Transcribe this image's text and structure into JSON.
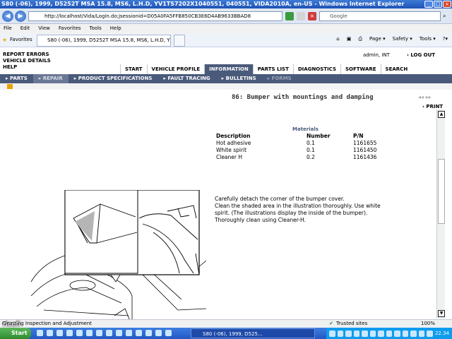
{
  "window": {
    "title": "S80 (-06), 1999, D5252T MSA 15.8, MS6, L.H.D, YV1TS7202X1040551, 040551, VIDA2010A, en-US - Windows Internet Explorer"
  },
  "browser": {
    "url": "http://localhost/Vida/Login.do;jsessionid=D05A0FA5FFB850CB3E6D4AB9633BBAD8",
    "search_placeholder": "Google",
    "menu": [
      "File",
      "Edit",
      "View",
      "Favorites",
      "Tools",
      "Help"
    ],
    "favorites_label": "Favorites",
    "tab_title": "S80 (-06), 1999, D5252T MSA 15.8, MS6, L.H.D, YV1...",
    "commands": [
      "Page ▾",
      "Safety ▾",
      "Tools ▾",
      "?▾"
    ]
  },
  "vida": {
    "header_links": [
      "REPORT ERRORS",
      "VEHICLE DETAILS",
      "HELP"
    ],
    "user": "admin, INT",
    "logout": "LOG OUT",
    "main_tabs": [
      "START",
      "VEHICLE PROFILE",
      "INFORMATION",
      "PARTS LIST",
      "DIAGNOSTICS",
      "SOFTWARE",
      "SEARCH"
    ],
    "sub_tabs": [
      "PARTS",
      "REPAIR",
      "PRODUCT SPECIFICATIONS",
      "FAULT TRACING",
      "BULLETINS",
      "FORMS"
    ]
  },
  "document": {
    "title": "86: Bumper with mountings and damping",
    "print": "PRINT",
    "materials": {
      "title": "Materials",
      "headers": [
        "Description",
        "Number",
        "P/N"
      ],
      "rows": [
        [
          "Hot adhesive",
          "0.1",
          "1161655"
        ],
        [
          "White spirit",
          "0.1",
          "1161450"
        ],
        [
          "Cleaner H",
          "0.2",
          "1161436"
        ]
      ]
    },
    "instructions": [
      "Carefully detach the corner of the bumper cover.",
      "Clean the shaded area in the illustration thoroughly. Use white spirit. (The illustrations display the inside of the bumper).",
      "Thoroughly clean using Cleaner-H."
    ]
  },
  "status": {
    "left": "Cleaning Inspection and Adjustment",
    "zone": "Trusted sites",
    "zoom": "100%"
  },
  "taskbar": {
    "start": "Start",
    "task": "S80 (-06), 1999, D525...",
    "clock": "22.34"
  },
  "watermark": "ricefi"
}
